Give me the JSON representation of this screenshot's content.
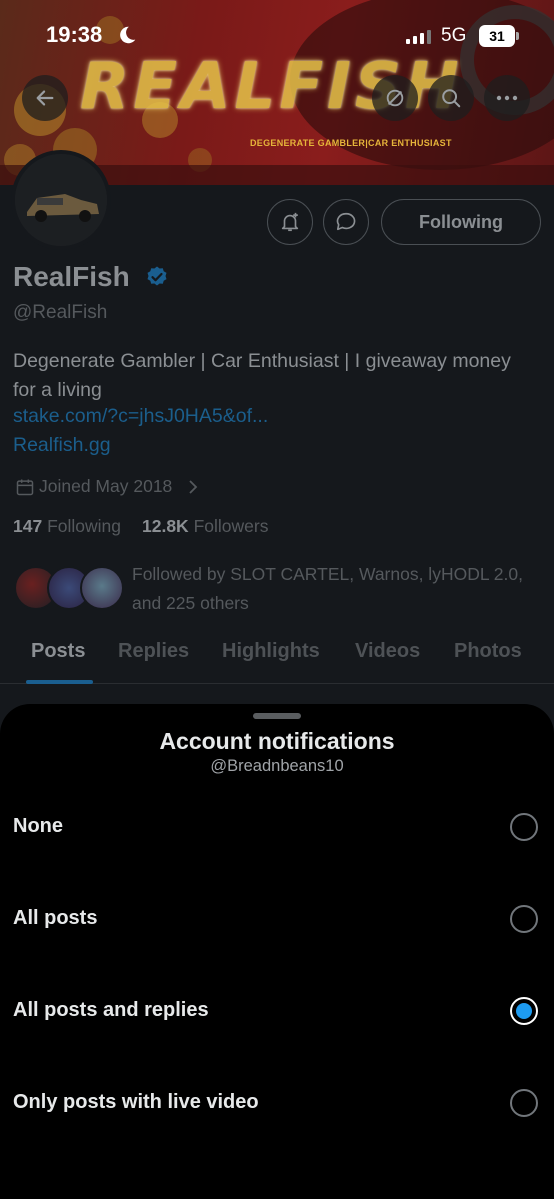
{
  "status_bar": {
    "time": "19:38",
    "network": "5G",
    "battery": "31"
  },
  "banner": {
    "title": "REALFISH",
    "subtitle": "DEGENERATE GAMBLER|CAR ENTHUSIAST"
  },
  "profile": {
    "name": "RealFish",
    "handle": "@RealFish",
    "bio": "Degenerate Gambler | Car Enthusiast | I giveaway money for a living",
    "link1": "stake.com/?c=jhsJ0HA5&of...",
    "link2": "Realfish.gg",
    "joined": "Joined May 2018",
    "following_count": "147",
    "following_label": "Following",
    "followers_count": "12.8K",
    "followers_label": "Followers",
    "followed_by": "Followed by SLOT CARTEL, Warnos, lyHODL 2.0, and 225 others",
    "follow_button": "Following"
  },
  "tabs": [
    {
      "label": "Posts",
      "active": true
    },
    {
      "label": "Replies",
      "active": false
    },
    {
      "label": "Highlights",
      "active": false
    },
    {
      "label": "Videos",
      "active": false
    },
    {
      "label": "Photos",
      "active": false
    }
  ],
  "sheet": {
    "title": "Account notifications",
    "subtitle": "@Breadnbeans10",
    "options": [
      {
        "label": "None",
        "selected": false
      },
      {
        "label": "All posts",
        "selected": false
      },
      {
        "label": "All posts and replies",
        "selected": true
      },
      {
        "label": "Only posts with live video",
        "selected": false
      }
    ]
  },
  "colors": {
    "accent": "#1d9bf0",
    "sheet_background": "#000000",
    "dimmed_page": "#15181c"
  },
  "icons": [
    "moon-icon",
    "signal-icon",
    "back-arrow-icon",
    "mute-icon",
    "search-icon",
    "more-icon",
    "bell-plus-icon",
    "message-icon",
    "verified-badge-icon",
    "calendar-icon",
    "chevron-right-icon"
  ]
}
